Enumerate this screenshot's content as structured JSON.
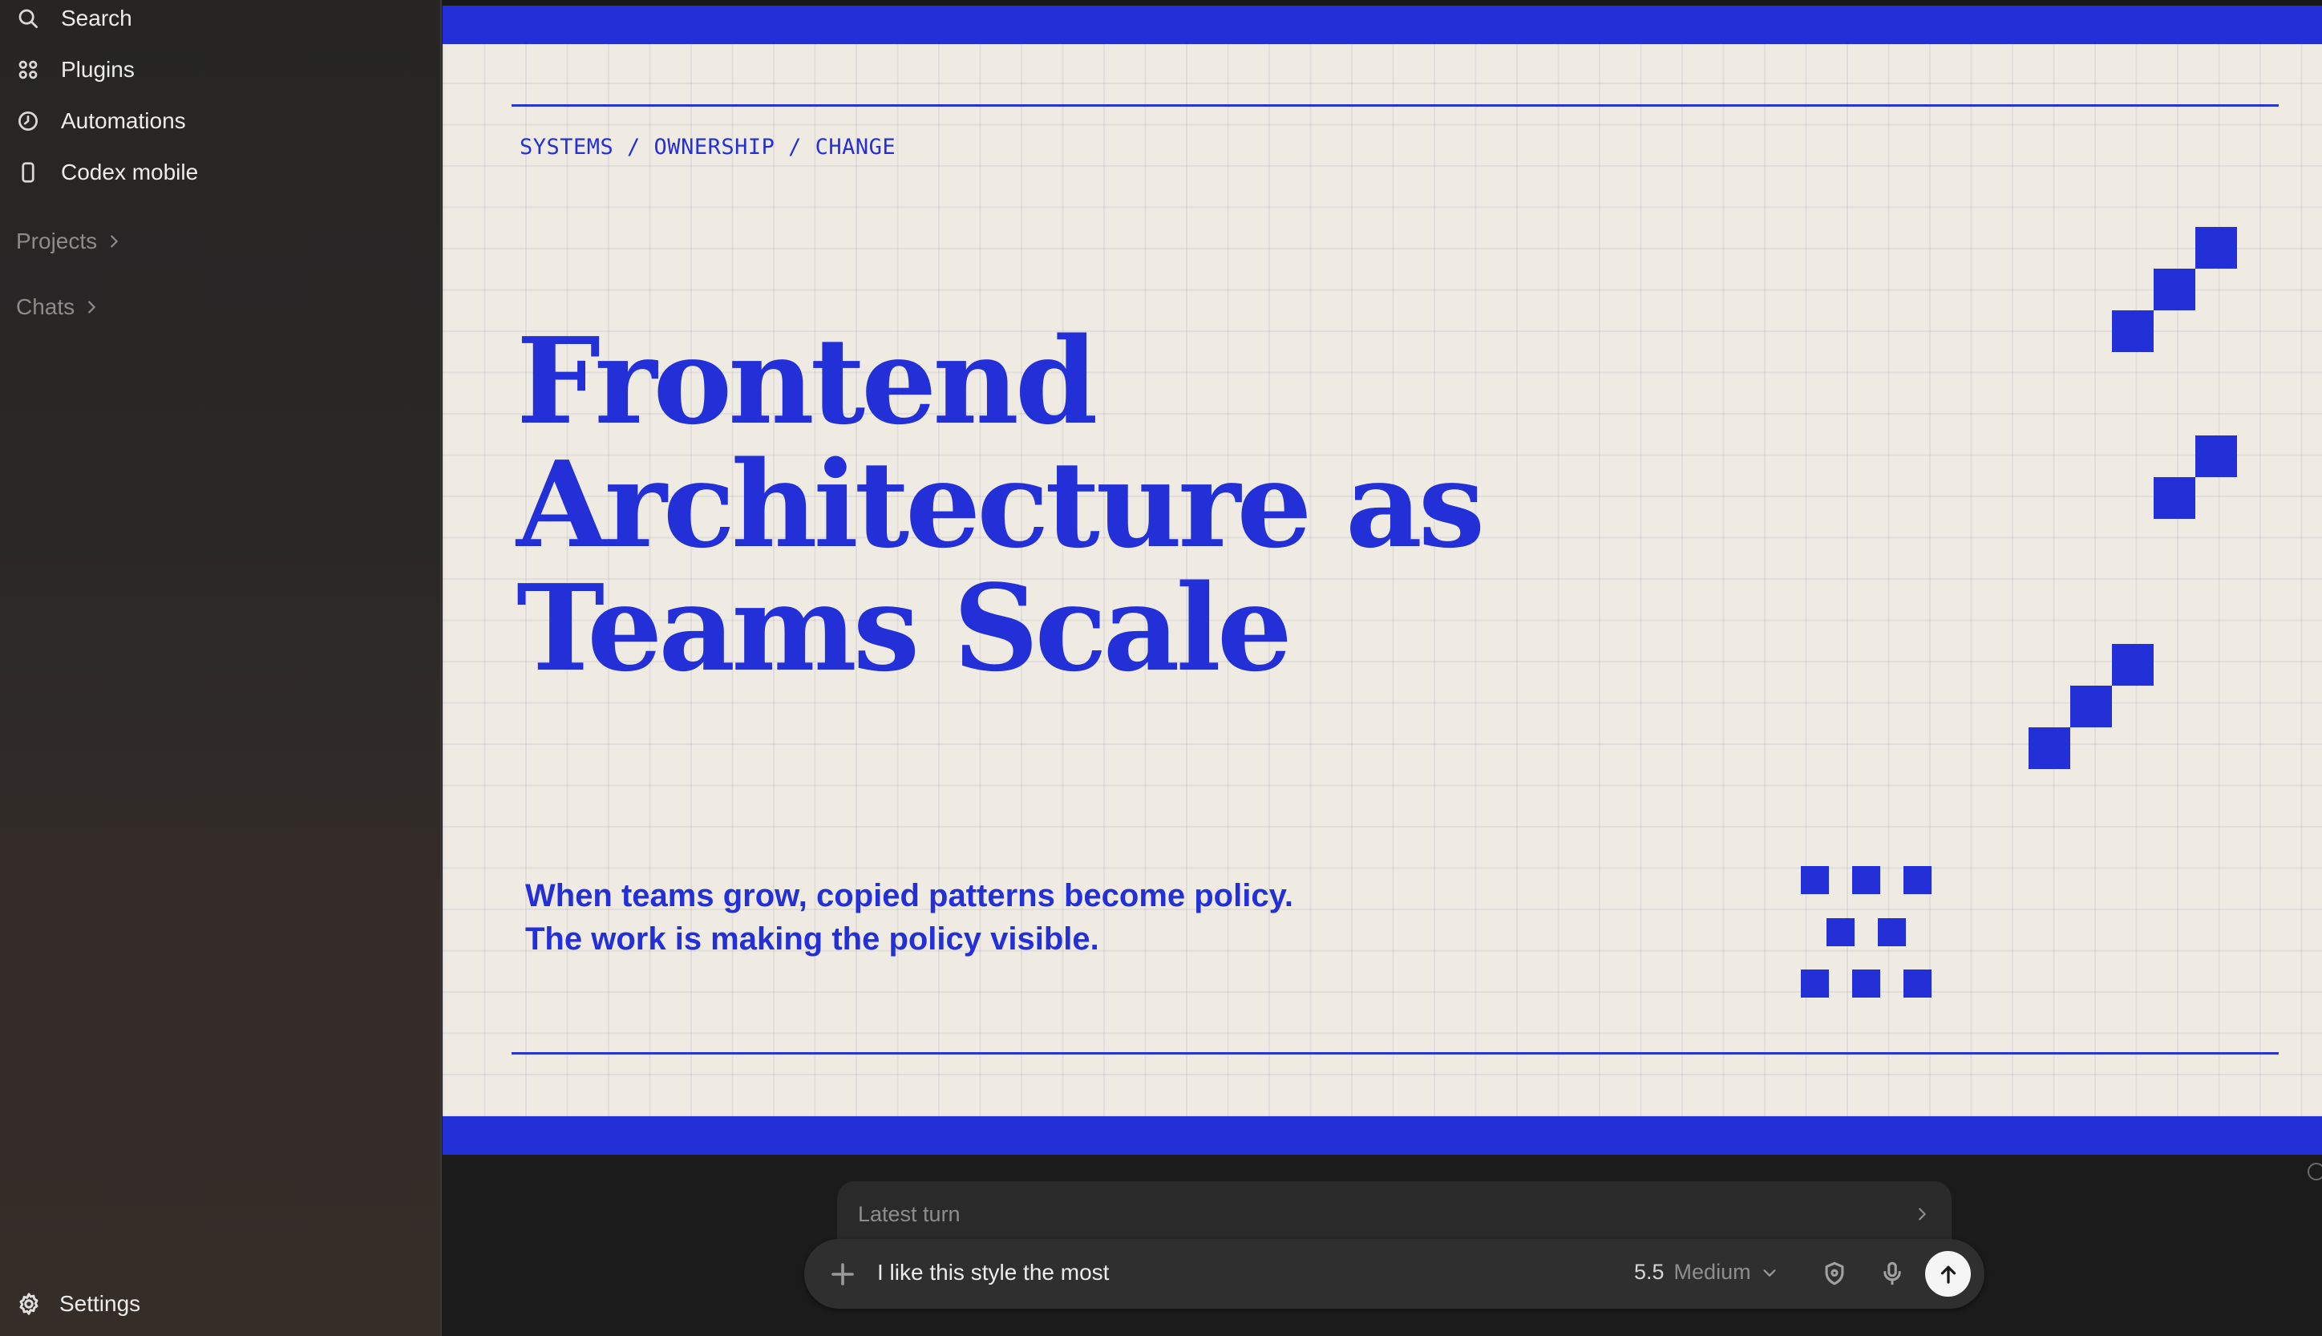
{
  "sidebar": {
    "items": [
      {
        "label": "Search",
        "icon": "search-icon"
      },
      {
        "label": "Plugins",
        "icon": "plugins-icon"
      },
      {
        "label": "Automations",
        "icon": "clock-icon"
      },
      {
        "label": "Codex mobile",
        "icon": "phone-icon"
      }
    ],
    "sections": [
      {
        "label": "Projects",
        "icon": "chevron-right-icon"
      },
      {
        "label": "Chats",
        "icon": "chevron-right-icon"
      }
    ],
    "settings_label": "Settings"
  },
  "slide": {
    "eyebrow": "SYSTEMS / OWNERSHIP / CHANGE",
    "title_lines": [
      "Frontend",
      "Architecture as",
      "Teams Scale"
    ],
    "subtitle_lines": [
      "When teams grow, copied patterns become policy.",
      "The work is making the policy visible."
    ]
  },
  "composer": {
    "latest_turn_label": "Latest turn",
    "input_value": "I like this style the most",
    "model_version": "5.5",
    "model_effort": "Medium"
  },
  "colors": {
    "accent_blue": "#2430d7",
    "slide_background": "#efebe2",
    "sidebar_background": "#2a2827",
    "app_background": "#1b1b1b"
  }
}
